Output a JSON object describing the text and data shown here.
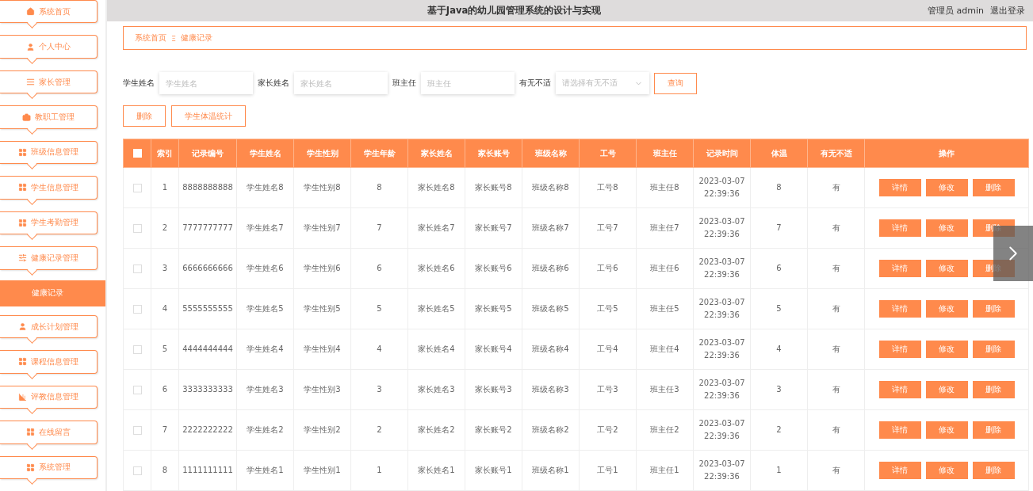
{
  "header": {
    "title": "基于Java的幼儿园管理系统的设计与实现",
    "user": "管理员 admin",
    "logout": "退出登录"
  },
  "sidebar": {
    "items": [
      {
        "label": "系统首页",
        "kind": "home",
        "selected": false
      },
      {
        "label": "个人中心",
        "kind": "user",
        "selected": false
      },
      {
        "label": "家长管理",
        "kind": "list",
        "selected": false
      },
      {
        "label": "教职工管理",
        "kind": "case",
        "selected": false
      },
      {
        "label": "班级信息管理",
        "kind": "grid",
        "selected": false
      },
      {
        "label": "学生信息管理",
        "kind": "grid",
        "selected": false
      },
      {
        "label": "学生考勤管理",
        "kind": "grid",
        "selected": false
      },
      {
        "label": "健康记录管理",
        "kind": "sliders",
        "selected": false,
        "expanded": true,
        "children": [
          {
            "label": "健康记录",
            "selected": true
          }
        ]
      },
      {
        "label": "成长计划管理",
        "kind": "person",
        "selected": false
      },
      {
        "label": "课程信息管理",
        "kind": "grid",
        "selected": false
      },
      {
        "label": "评教信息管理",
        "kind": "chart",
        "selected": false
      },
      {
        "label": "在线留言",
        "kind": "grid",
        "selected": false
      },
      {
        "label": "系统管理",
        "kind": "grid",
        "selected": false
      }
    ]
  },
  "breadcrumb": [
    "系统首页",
    "健康记录"
  ],
  "breadcrumb_separator": "Ξ",
  "search": {
    "fields": [
      {
        "label": "学生姓名",
        "placeholder": "学生姓名",
        "kind": "text"
      },
      {
        "label": "家长姓名",
        "placeholder": "家长姓名",
        "kind": "text"
      },
      {
        "label": "班主任",
        "placeholder": "班主任",
        "kind": "text"
      },
      {
        "label": "有无不适",
        "placeholder": "请选择有无不适",
        "kind": "select"
      }
    ],
    "button": "查询"
  },
  "actions": [
    "删除",
    "学生体温统计"
  ],
  "table": {
    "columns": [
      "索引",
      "记录编号",
      "学生姓名",
      "学生性别",
      "学生年龄",
      "家长姓名",
      "家长账号",
      "班级名称",
      "工号",
      "班主任",
      "记录时间",
      "体温",
      "有无不适",
      "操作"
    ],
    "header_checked": false,
    "rows": [
      {
        "checked": false,
        "cells": [
          "1",
          "8888888888",
          "学生姓名8",
          "学生性别8",
          "8",
          "家长姓名8",
          "家长账号8",
          "班级名称8",
          "工号8",
          "班主任8",
          "2023-03-07 22:39:36",
          "8",
          "有"
        ],
        "buttons": [
          "详情",
          "修改",
          "删除"
        ]
      },
      {
        "checked": false,
        "cells": [
          "2",
          "7777777777",
          "学生姓名7",
          "学生性别7",
          "7",
          "家长姓名7",
          "家长账号7",
          "班级名称7",
          "工号7",
          "班主任7",
          "2023-03-07 22:39:36",
          "7",
          "有"
        ],
        "buttons": [
          "详情",
          "修改",
          "删除"
        ]
      },
      {
        "checked": false,
        "cells": [
          "3",
          "6666666666",
          "学生姓名6",
          "学生性别6",
          "6",
          "家长姓名6",
          "家长账号6",
          "班级名称6",
          "工号6",
          "班主任6",
          "2023-03-07 22:39:36",
          "6",
          "有"
        ],
        "buttons": [
          "详情",
          "修改",
          "删除"
        ]
      },
      {
        "checked": false,
        "cells": [
          "4",
          "5555555555",
          "学生姓名5",
          "学生性别5",
          "5",
          "家长姓名5",
          "家长账号5",
          "班级名称5",
          "工号5",
          "班主任5",
          "2023-03-07 22:39:36",
          "5",
          "有"
        ],
        "buttons": [
          "详情",
          "修改",
          "删除"
        ]
      },
      {
        "checked": false,
        "cells": [
          "5",
          "4444444444",
          "学生姓名4",
          "学生性别4",
          "4",
          "家长姓名4",
          "家长账号4",
          "班级名称4",
          "工号4",
          "班主任4",
          "2023-03-07 22:39:36",
          "4",
          "有"
        ],
        "buttons": [
          "详情",
          "修改",
          "删除"
        ]
      },
      {
        "checked": false,
        "cells": [
          "6",
          "3333333333",
          "学生姓名3",
          "学生性别3",
          "3",
          "家长姓名3",
          "家长账号3",
          "班级名称3",
          "工号3",
          "班主任3",
          "2023-03-07 22:39:36",
          "3",
          "有"
        ],
        "buttons": [
          "详情",
          "修改",
          "删除"
        ]
      },
      {
        "checked": false,
        "cells": [
          "7",
          "2222222222",
          "学生姓名2",
          "学生性别2",
          "2",
          "家长姓名2",
          "家长账号2",
          "班级名称2",
          "工号2",
          "班主任2",
          "2023-03-07 22:39:36",
          "2",
          "有"
        ],
        "buttons": [
          "详情",
          "修改",
          "删除"
        ]
      },
      {
        "checked": false,
        "cells": [
          "8",
          "1111111111",
          "学生姓名1",
          "学生性别1",
          "1",
          "家长姓名1",
          "家长账号1",
          "班级名称1",
          "工号1",
          "班主任1",
          "2023-03-07 22:39:36",
          "1",
          "有"
        ],
        "buttons": [
          "详情",
          "修改",
          "删除"
        ]
      }
    ]
  },
  "next_arrow": {
    "visible": true
  }
}
